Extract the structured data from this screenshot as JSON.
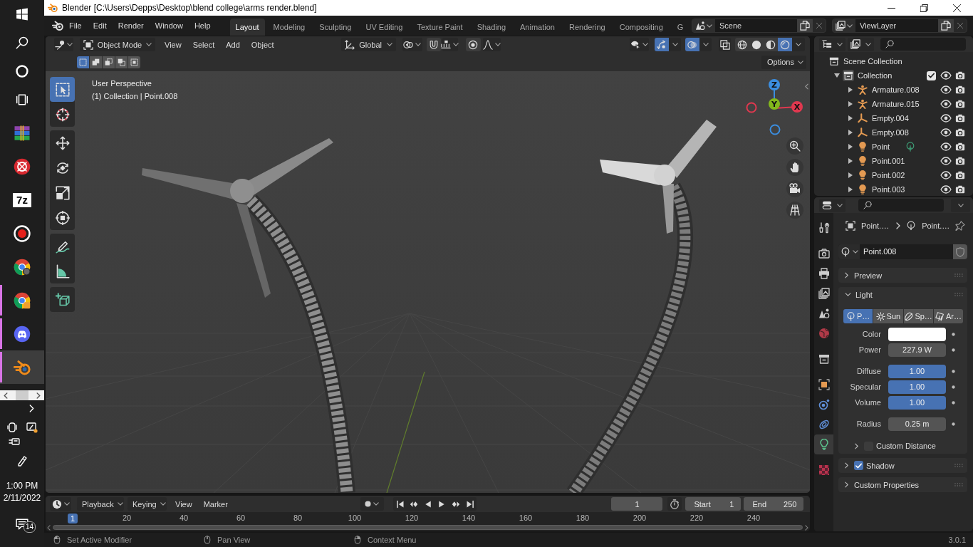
{
  "taskbar": {
    "apps": [
      {
        "kind": "winrar",
        "open": false,
        "selected": false
      },
      {
        "kind": "redapp",
        "open": false,
        "selected": false
      },
      {
        "kind": "archiver",
        "label": "7z",
        "open": false,
        "selected": false
      },
      {
        "kind": "recorder",
        "open": false,
        "selected": false
      },
      {
        "kind": "chrome",
        "open": false,
        "selected": false
      },
      {
        "kind": "chromeapp",
        "open": true,
        "selected": false
      },
      {
        "kind": "discord",
        "open": true,
        "selected": false
      },
      {
        "kind": "blender",
        "open": true,
        "selected": true
      }
    ],
    "time": "1:00 PM",
    "date": "2/11/2022",
    "notifications": "14"
  },
  "window": {
    "title": "Blender [C:\\Users\\Depps\\Desktop\\blend college\\arms render.blend]"
  },
  "top_bar": {
    "menus": [
      "File",
      "Edit",
      "Render",
      "Window",
      "Help"
    ],
    "workspaces": [
      {
        "label": "Layout",
        "selected": true
      },
      {
        "label": "Modeling",
        "selected": false
      },
      {
        "label": "Sculpting",
        "selected": false
      },
      {
        "label": "UV Editing",
        "selected": false
      },
      {
        "label": "Texture Paint",
        "selected": false
      },
      {
        "label": "Shading",
        "selected": false
      },
      {
        "label": "Animation",
        "selected": false
      },
      {
        "label": "Rendering",
        "selected": false
      },
      {
        "label": "Compositing",
        "selected": false
      },
      {
        "label": "G",
        "selected": false
      }
    ],
    "scene": "Scene",
    "view_layer": "ViewLayer"
  },
  "viewport": {
    "header": {
      "mode": "Object Mode",
      "menus": [
        "View",
        "Select",
        "Add",
        "Object"
      ],
      "orientation": "Global",
      "snap": false,
      "proportional_editing": false,
      "gizmos": true,
      "overlays": true,
      "xray": false,
      "shading": [
        {
          "kind": "wireframe",
          "selected": false
        },
        {
          "kind": "solid",
          "selected": false
        },
        {
          "kind": "material",
          "selected": false
        },
        {
          "kind": "rendered",
          "selected": true
        }
      ]
    },
    "select_modes": [
      {
        "kind": "set",
        "selected": true
      },
      {
        "kind": "extend",
        "selected": false
      },
      {
        "kind": "subtract",
        "selected": false
      },
      {
        "kind": "invert",
        "selected": false
      },
      {
        "kind": "intersect",
        "selected": false
      }
    ],
    "options": "Options",
    "info": [
      "User Perspective",
      "(1) Collection | Point.008"
    ],
    "tool_groups": [
      [
        {
          "kind": "select_box",
          "selected": true
        },
        {
          "kind": "cursor",
          "selected": false
        }
      ],
      [
        {
          "kind": "move",
          "selected": false
        },
        {
          "kind": "rotate",
          "selected": false
        },
        {
          "kind": "scale",
          "selected": false
        },
        {
          "kind": "transform",
          "selected": false
        }
      ],
      [
        {
          "kind": "annotate",
          "selected": false
        },
        {
          "kind": "measure",
          "selected": false
        }
      ],
      [
        {
          "kind": "add_cube",
          "selected": false
        }
      ]
    ],
    "gizmo": [
      {
        "kind": "negx",
        "color": "#e0384f"
      },
      {
        "kind": "negz",
        "color": "#3b8ee0"
      },
      {
        "kind": "z",
        "label": "Z",
        "color": "#3b8ee0"
      },
      {
        "kind": "x",
        "label": "X",
        "color": "#e0384f"
      },
      {
        "kind": "y",
        "label": "Y",
        "color": "#83b81c"
      }
    ]
  },
  "outliner": {
    "tree": [
      {
        "label": "Scene Collection",
        "kind": "scene_collection",
        "active": false,
        "children": [
          {
            "label": "Collection",
            "kind": "collection",
            "active": true,
            "expanded": true,
            "checked": true,
            "visible": true,
            "renderable": true,
            "children": [
              {
                "label": "Armature.008",
                "kind": "armature",
                "expanded": false,
                "visible": true,
                "renderable": true,
                "active_data": false
              },
              {
                "label": "Armature.015",
                "kind": "armature",
                "expanded": false,
                "visible": true,
                "renderable": true,
                "active_data": false
              },
              {
                "label": "Empty.004",
                "kind": "empty",
                "expanded": false,
                "visible": true,
                "renderable": true,
                "active_data": false
              },
              {
                "label": "Empty.008",
                "kind": "empty",
                "expanded": false,
                "visible": true,
                "renderable": true,
                "active_data": false
              },
              {
                "label": "Point",
                "kind": "light",
                "expanded": false,
                "visible": true,
                "renderable": true,
                "active_data": true
              },
              {
                "label": "Point.001",
                "kind": "light",
                "expanded": false,
                "visible": true,
                "renderable": true,
                "active_data": false
              },
              {
                "label": "Point.002",
                "kind": "light",
                "expanded": false,
                "visible": true,
                "renderable": true,
                "active_data": false
              },
              {
                "label": "Point.003",
                "kind": "light",
                "expanded": false,
                "visible": true,
                "renderable": true,
                "active_data": false
              }
            ]
          }
        ]
      }
    ]
  },
  "properties": {
    "tab_groups": [
      [
        {
          "kind": "tool",
          "selected": false
        }
      ],
      [
        {
          "kind": "render",
          "selected": false
        },
        {
          "kind": "output",
          "selected": false
        },
        {
          "kind": "view_layer",
          "selected": false
        },
        {
          "kind": "scene",
          "selected": false
        },
        {
          "kind": "world",
          "selected": false
        }
      ],
      [
        {
          "kind": "collection",
          "selected": false
        }
      ],
      [
        {
          "kind": "object",
          "selected": false
        },
        {
          "kind": "physics",
          "selected": false
        },
        {
          "kind": "constraints",
          "selected": false
        },
        {
          "kind": "light",
          "selected": true
        }
      ],
      [
        {
          "kind": "texture",
          "selected": false
        }
      ]
    ],
    "breadcrumb": [
      "Point.…",
      "Point.…"
    ],
    "datablock": "Point.008",
    "panels": [
      {
        "title": "Preview",
        "expanded": false
      },
      {
        "title": "Light",
        "expanded": true,
        "light_types": [
          {
            "kind": "point",
            "label": "P…",
            "selected": true
          },
          {
            "kind": "sun",
            "label": "Sun",
            "selected": false
          },
          {
            "kind": "spot",
            "label": "Sp…",
            "selected": false
          },
          {
            "kind": "area",
            "label": "Ar…",
            "selected": false
          }
        ],
        "field_groups": [
          [
            {
              "kind": "color",
              "label": "Color",
              "color": "#ffffff"
            },
            {
              "kind": "number",
              "label": "Power",
              "value": "227.9 W"
            }
          ],
          [
            {
              "kind": "slider",
              "label": "Diffuse",
              "value": "1.00",
              "level": 1
            },
            {
              "kind": "slider",
              "label": "Specular",
              "value": "1.00",
              "level": 1
            },
            {
              "kind": "slider",
              "label": "Volume",
              "value": "1.00",
              "level": 1
            }
          ],
          [
            {
              "kind": "number",
              "label": "Radius",
              "value": "0.25 m"
            }
          ]
        ],
        "subpanels": [
          {
            "title": "Custom Distance",
            "expanded": false,
            "checked": false
          }
        ]
      },
      {
        "title": "Shadow",
        "expanded": false,
        "checked": true
      },
      {
        "title": "Custom Properties",
        "expanded": false
      }
    ]
  },
  "timeline": {
    "menus": [
      {
        "label": "Playback",
        "dropdown": true
      },
      {
        "label": "Keying",
        "dropdown": true
      },
      {
        "label": "View",
        "dropdown": false
      },
      {
        "label": "Marker",
        "dropdown": false
      }
    ],
    "auto_keying": false,
    "current_frame": "1",
    "start_label": "Start",
    "start": "1",
    "end_label": "End",
    "end": "250",
    "ruler": [
      "20",
      "40",
      "60",
      "80",
      "100",
      "120",
      "140",
      "160",
      "180",
      "200",
      "220",
      "240"
    ],
    "playhead": "1"
  },
  "status_bar": {
    "hints": [
      {
        "kind": "left",
        "label": "Set Active Modifier"
      },
      {
        "kind": "middle",
        "label": "Pan View"
      },
      {
        "kind": "right",
        "label": "Context Menu"
      }
    ],
    "version": "3.0.1"
  }
}
